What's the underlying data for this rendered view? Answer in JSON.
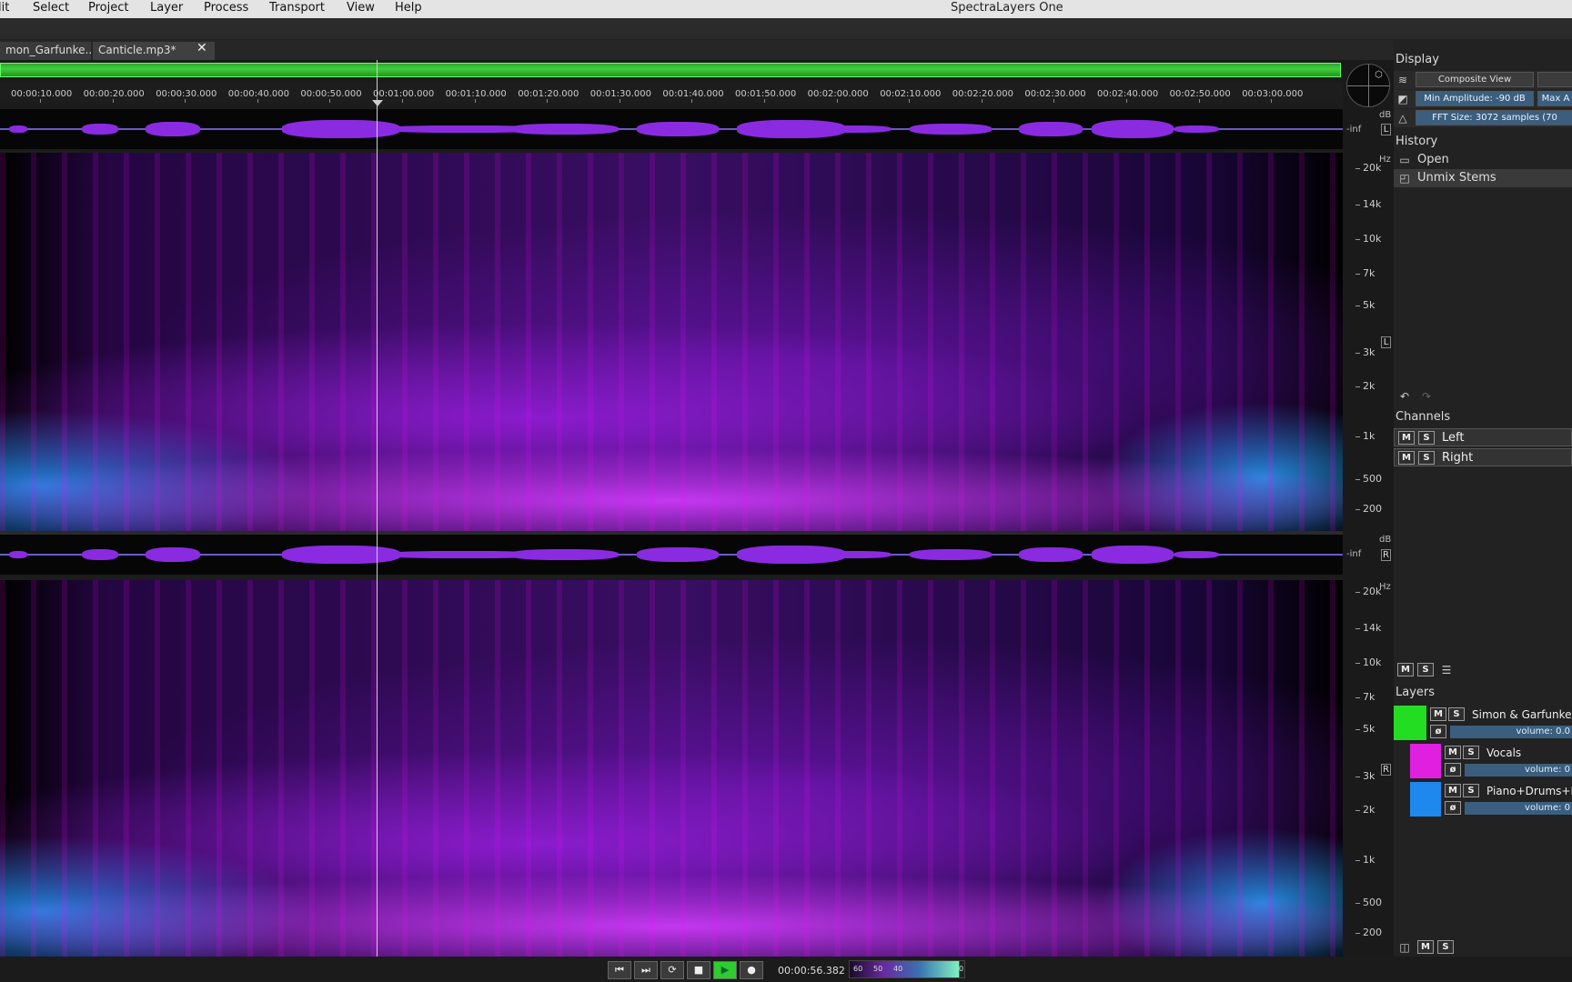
{
  "menubar": {
    "items": [
      "lit",
      "Select",
      "Project",
      "Layer",
      "Process",
      "Transport",
      "View",
      "Help"
    ],
    "title": "SpectraLayers One"
  },
  "tabs": [
    "mon_Garfunke...",
    "Canticle.mp3*"
  ],
  "timeline": {
    "labels": [
      "00:00:10.000",
      "00:00:20.000",
      "00:00:30.000",
      "00:00:40.000",
      "00:00:50.000",
      "00:01:00.000",
      "00:01:10.000",
      "00:01:20.000",
      "00:01:30.000",
      "00:01:40.000",
      "00:01:50.000",
      "00:02:00.000",
      "00:02:10.000",
      "00:02:20.000",
      "00:02:30.000",
      "00:02:40.000",
      "00:02:50.000",
      "00:03:00.000"
    ]
  },
  "axes": {
    "db_label": "dB",
    "hz_label": "Hz",
    "inf_label": "-inf",
    "hz_ticks": [
      "20k",
      "14k",
      "10k",
      "7k",
      "5k",
      "3k",
      "2k",
      "1k",
      "500",
      "200"
    ],
    "left_channel": "L",
    "right_channel": "R"
  },
  "panel": {
    "display": {
      "title": "Display",
      "composite_view": "Composite View",
      "min_amplitude": "Min Amplitude: -90 dB",
      "max_amplitude": "Max A",
      "fft_size": "FFT Size: 3072 samples (70"
    },
    "history": {
      "title": "History",
      "items": [
        "Open",
        "Unmix Stems"
      ]
    },
    "channels": {
      "title": "Channels",
      "mute": "M",
      "solo": "S",
      "items": [
        "Left",
        "Right"
      ]
    },
    "layers": {
      "title": "Layers",
      "items": [
        {
          "name": "Simon & Garfunkel",
          "volume": "volume: 0.0",
          "color": "#22dd22"
        },
        {
          "name": "Vocals",
          "volume": "volume: 0",
          "color": "#e020e0"
        },
        {
          "name": "Piano+Drums+B",
          "volume": "volume: 0",
          "color": "#1e88ee"
        }
      ]
    }
  },
  "transport": {
    "timecode": "00:00:56.382",
    "meter_labels": [
      "60",
      "50",
      "40",
      "0"
    ]
  }
}
